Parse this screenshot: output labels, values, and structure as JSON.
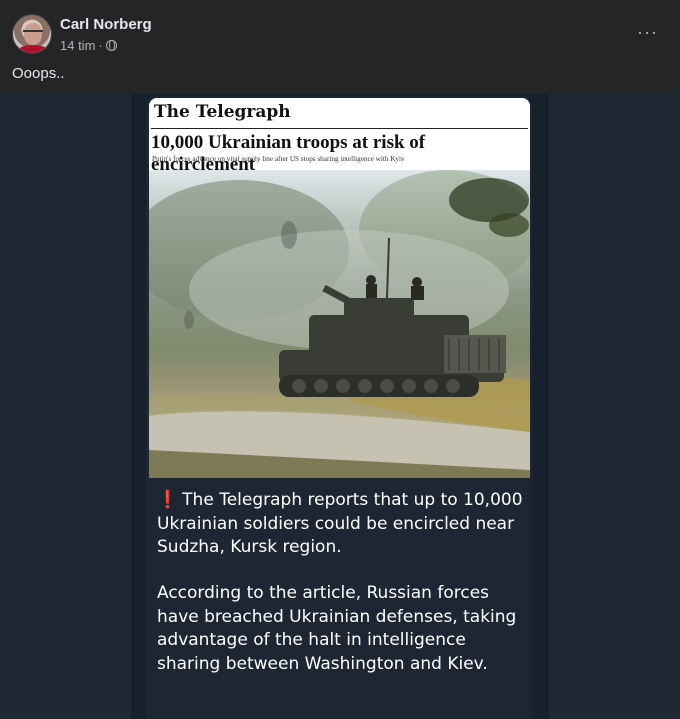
{
  "post": {
    "author": "Carl Norberg",
    "time": "14 tim",
    "separator": "·",
    "caption": "Ooops..",
    "more_label": "···",
    "icons": {
      "avatar": "avatar",
      "audience": "globe-icon",
      "more": "more-icon"
    }
  },
  "article": {
    "masthead": "The Telegraph",
    "headline": "10,000 Ukrainian troops at risk of encirclement",
    "standfirst": "Putin's forces advance on vital supply line after US stops sharing intelligence with Kyiv",
    "photo": "tank-photo"
  },
  "message": {
    "alert_icon": "❗",
    "paragraph1": "The Telegraph reports that up to 10,000 Ukrainian soldiers could be encircled near Sudzha, Kursk region.",
    "paragraph2": "According to the article, Russian forces have breached Ukrainian defenses, taking advantage of the halt in intelligence sharing between Washington and Kiev."
  },
  "colors": {
    "background": "#242526",
    "chat_background": "#1d2733",
    "text": "#e4e6eb",
    "muted": "#b0b3b8",
    "alert": "#e8333e"
  }
}
